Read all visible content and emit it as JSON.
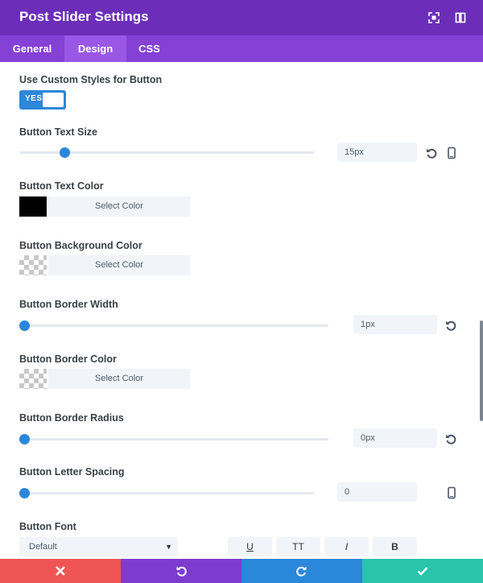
{
  "header": {
    "title": "Post Slider Settings"
  },
  "tabs": [
    {
      "label": "General"
    },
    {
      "label": "Design"
    },
    {
      "label": "CSS"
    }
  ],
  "settings": {
    "custom_styles": {
      "label": "Use Custom Styles for Button",
      "toggle": "YES"
    },
    "text_size": {
      "label": "Button Text Size",
      "value": "15px",
      "slider_fraction": 0.15
    },
    "text_color": {
      "label": "Button Text Color",
      "button": "Select Color",
      "swatch": "#000000"
    },
    "bg_color": {
      "label": "Button Background Color",
      "button": "Select Color"
    },
    "border_width": {
      "label": "Button Border Width",
      "value": "1px",
      "slider_fraction": 0.0
    },
    "border_color": {
      "label": "Button Border Color",
      "button": "Select Color"
    },
    "border_radius": {
      "label": "Button Border Radius",
      "value": "0px",
      "slider_fraction": 0.0
    },
    "letter_spacing": {
      "label": "Button Letter Spacing",
      "value": "0",
      "slider_fraction": 0.0
    },
    "font": {
      "label": "Button Font",
      "selected": "Default"
    },
    "font_styles": {
      "underline": "U",
      "uppercase": "TT",
      "italic": "I",
      "bold": "B"
    }
  },
  "colors": {
    "header": "#6c2eb9",
    "tabs": "#8540d6",
    "accent": "#2b87da",
    "footer_cancel": "#ef5555",
    "footer_undo": "#7e3bd0",
    "footer_redo": "#2b87da",
    "footer_save": "#29c4a9"
  }
}
